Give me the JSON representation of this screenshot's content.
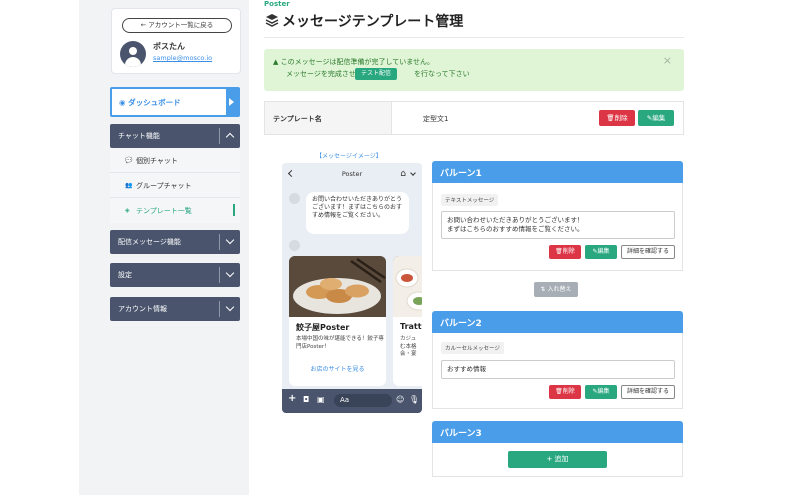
{
  "sidebar": {
    "back_label": "← アカウント一覧に戻る",
    "user_name": "ポスたん",
    "user_email": "sample@mosco.io",
    "dashboard_label": "ダッシュボード",
    "menus": {
      "chat": "チャット機能",
      "broadcast": "配信メッセージ機能",
      "settings": "設定",
      "account": "アカウント情報"
    },
    "subitems": {
      "individual": "個別チャット",
      "group": "グループチャット",
      "template": "テンプレート一覧"
    }
  },
  "header": {
    "brand": "Poster",
    "title": "メッセージテンプレート管理"
  },
  "alert": {
    "line1": "このメッセージは配信準備が完了していません。",
    "line2_pre": "メッセージを完成させて",
    "button": "テスト配信",
    "line2_post": "を行なって下さい",
    "close": "×"
  },
  "template": {
    "label": "テンプレート名",
    "value": "定型文1",
    "delete": "削除",
    "edit": "編集"
  },
  "preview": {
    "label": "【メッセージイメージ】",
    "phone_title": "Poster",
    "bubble_text": "お問い合わせいただきありがとうございます！まずはこちらのおすすめ情報をご覧ください。",
    "card1": {
      "name": "餃子屋Poster",
      "desc": "本場中国の味が堪能できる！餃子専門店Poster！",
      "link": "お店のサイトを見る"
    },
    "card2": {
      "name": "Tratt",
      "desc": "カジュ\nむ本格\n会・宴"
    },
    "input_placeholder": "Aa"
  },
  "balloons": [
    {
      "title": "バルーン1",
      "type": "テキストメッセージ",
      "content": "お問い合わせいただきありがとうございます！\nまずはこちらのおすすめ情報をご覧ください。",
      "delete": "削除",
      "edit": "編集",
      "detail": "詳細を確認する"
    },
    {
      "title": "バルーン2",
      "type": "カルーセルメッセージ",
      "content": "おすすめ情報",
      "delete": "削除",
      "edit": "編集",
      "detail": "詳細を確認する"
    },
    {
      "title": "バルーン3",
      "add": "+ 追加"
    }
  ],
  "swap_label": "⇅ 入れ替え",
  "colors": {
    "primary_blue": "#4a9de8",
    "accent_green": "#29a87f",
    "danger_red": "#dc3545",
    "nav_dark": "#4a556d"
  }
}
